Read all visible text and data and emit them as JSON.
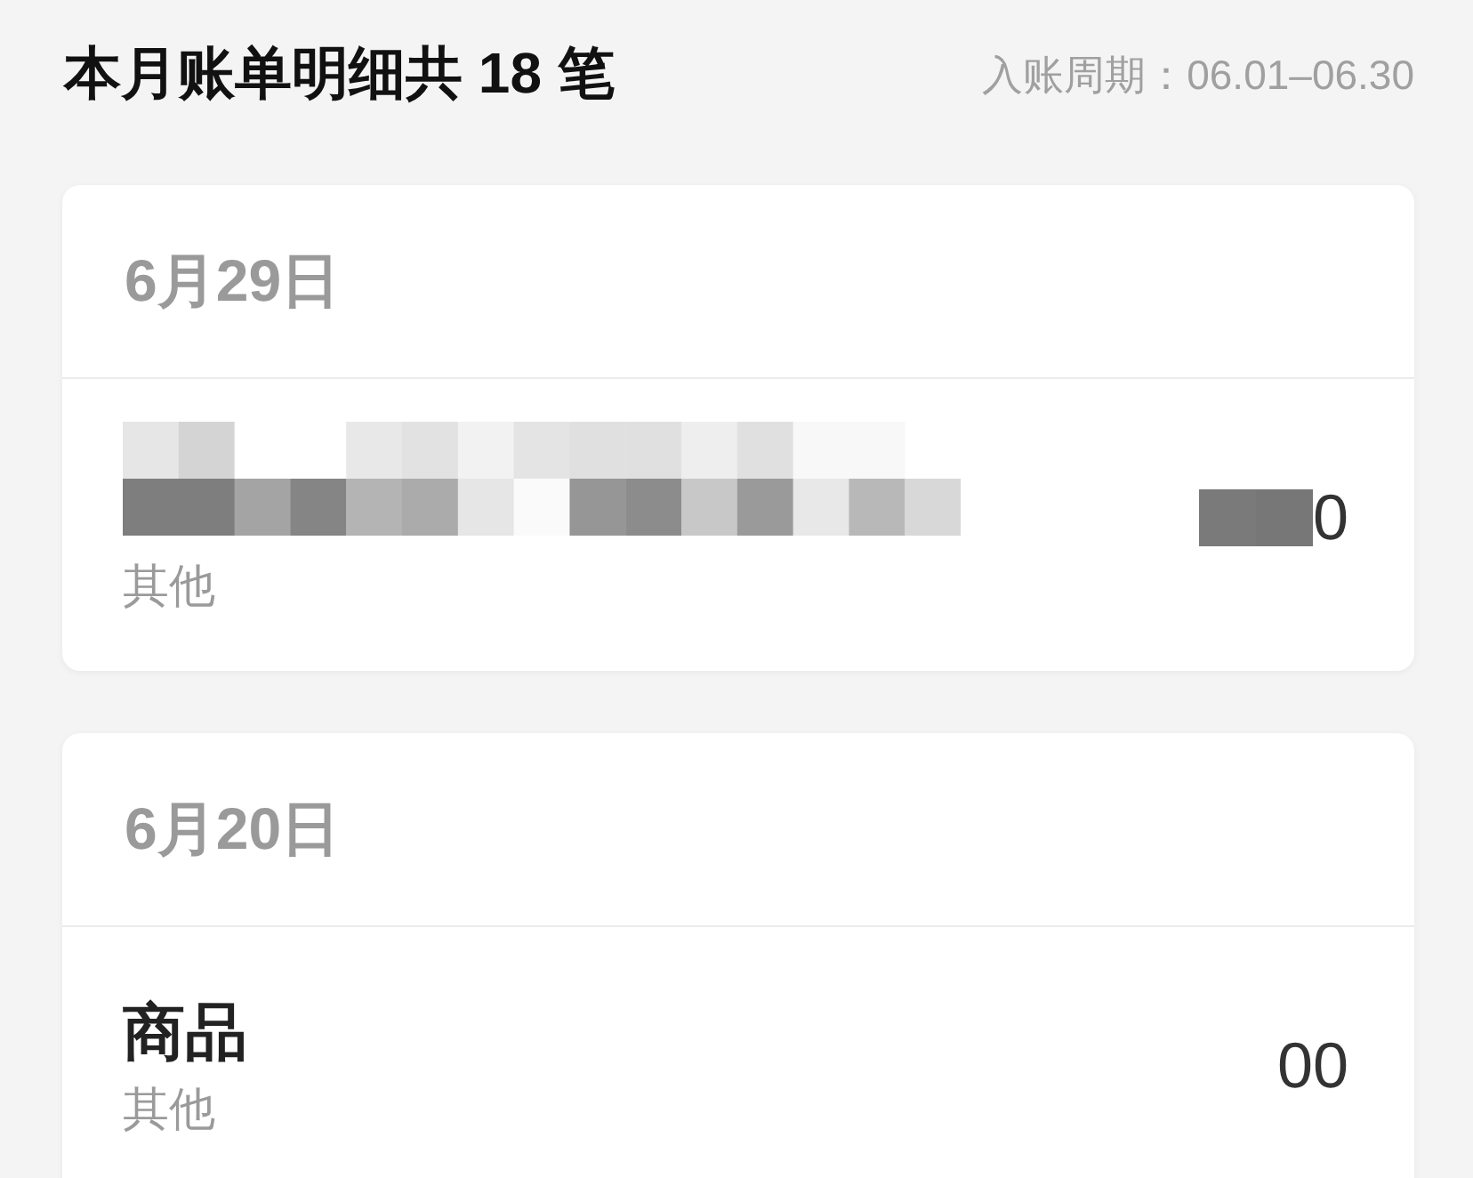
{
  "header": {
    "title": "本月账单明细共 18 笔",
    "period": "入账周期：06.01–06.30"
  },
  "days": [
    {
      "date": "6月29日",
      "entries": [
        {
          "title_redacted": true,
          "category": "其他",
          "amount": "0",
          "amount_redacted": true
        }
      ]
    },
    {
      "date": "6月20日",
      "entries": [
        {
          "title": "商品",
          "title_redacted": false,
          "category": "其他",
          "amount": "00",
          "amount_redacted": false
        }
      ]
    }
  ]
}
